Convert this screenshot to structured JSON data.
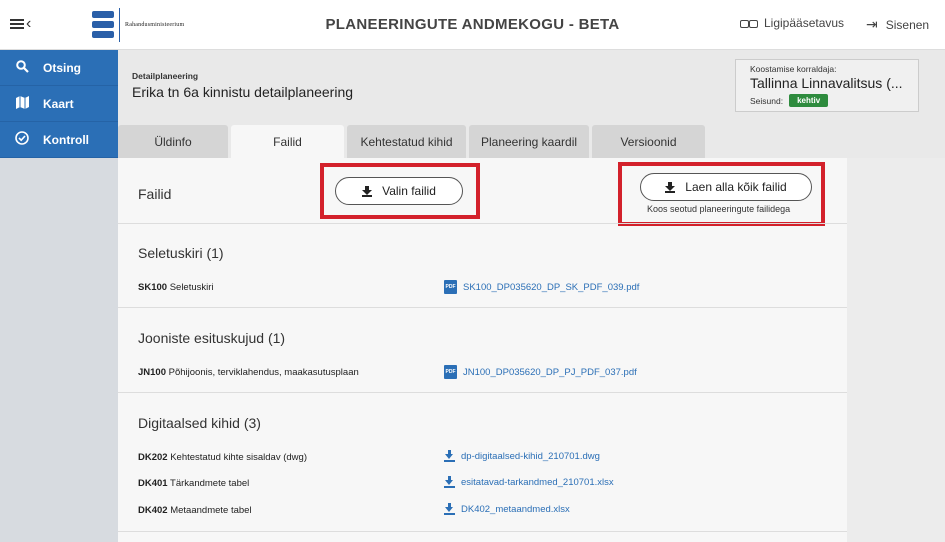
{
  "header": {
    "menu_chevron": "‹",
    "logo_text": "Rahandusministeerium",
    "app_title": "PLANEERINGUTE ANDMEKOGU - BETA",
    "accessibility_label": "Ligipääsetavus",
    "signin_label": "Sisenen"
  },
  "sidebar": {
    "items": [
      {
        "label": "Otsing",
        "icon": "search-icon"
      },
      {
        "label": "Kaart",
        "icon": "map-icon"
      },
      {
        "label": "Kontroll",
        "icon": "check-circle-icon"
      }
    ]
  },
  "plan": {
    "type": "Detailplaneering",
    "name": "Erika tn 6a kinnistu detailplaneering",
    "org_label": "Koostamise korraldaja:",
    "org_name": "Tallinna Linnavalitsus (...",
    "status_label": "Seisund:",
    "status_value": "kehtiv"
  },
  "tabs": [
    {
      "label": "Üldinfo",
      "active": false
    },
    {
      "label": "Failid",
      "active": true
    },
    {
      "label": "Kehtestatud kihid",
      "active": false
    },
    {
      "label": "Planeering kaardil",
      "active": false
    },
    {
      "label": "Versioonid",
      "active": false
    }
  ],
  "files": {
    "title": "Failid",
    "select_button": "Valin failid",
    "download_all_button": "Laen alla kõik failid",
    "download_all_sub": "Koos seotud planeeringute failidega"
  },
  "sections": [
    {
      "title": "Seletuskiri (1)",
      "rows": [
        {
          "code": "SK100",
          "desc": "Seletuskiri",
          "file": "SK100_DP035620_DP_SK_PDF_039.pdf",
          "icon": "pdf-icon"
        }
      ]
    },
    {
      "title": "Jooniste esituskujud (1)",
      "rows": [
        {
          "code": "JN100",
          "desc": "Põhijoonis, terviklahendus, maakasutusplaan",
          "file": "JN100_DP035620_DP_PJ_PDF_037.pdf",
          "icon": "pdf-icon"
        }
      ]
    },
    {
      "title": "Digitaalsed kihid (3)",
      "rows": [
        {
          "code": "DK202",
          "desc": "Kehtestatud kihte sisaldav (dwg)",
          "file": "dp-digitaalsed-kihid_210701.dwg",
          "icon": "download-icon"
        },
        {
          "code": "DK401",
          "desc": "Tärkandmete tabel",
          "file": "esitatavad-tarkandmed_210701.xlsx",
          "icon": "download-icon"
        },
        {
          "code": "DK402",
          "desc": "Metaandmete tabel",
          "file": "DK402_metaandmed.xlsx",
          "icon": "download-icon"
        }
      ]
    }
  ],
  "colors": {
    "accent": "#2b6fb6",
    "highlight": "#d3212b",
    "status": "#2e8b3e"
  }
}
